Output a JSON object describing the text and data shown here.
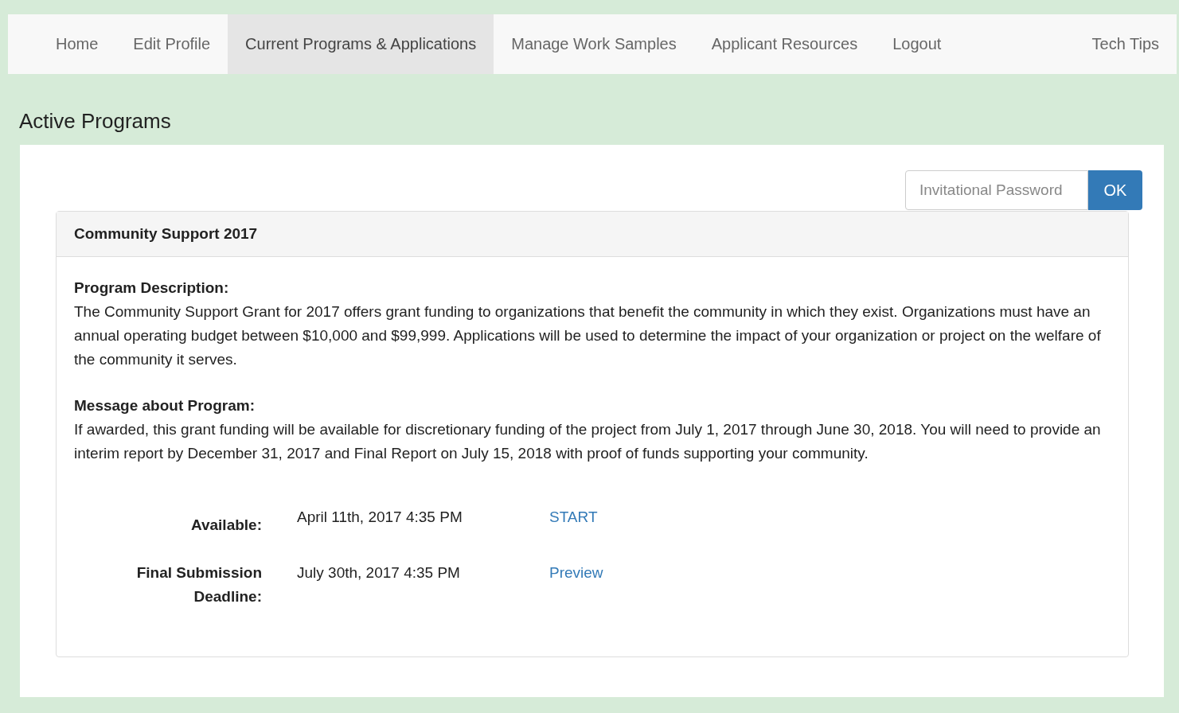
{
  "nav": {
    "items": [
      {
        "label": "Home",
        "selected": false
      },
      {
        "label": "Edit Profile",
        "selected": false
      },
      {
        "label": "Current Programs & Applications",
        "selected": true
      },
      {
        "label": "Manage Work Samples",
        "selected": false
      },
      {
        "label": "Applicant Resources",
        "selected": false
      },
      {
        "label": "Logout",
        "selected": false
      }
    ],
    "right_item": {
      "label": "Tech Tips",
      "selected": false
    }
  },
  "heading": "Active Programs",
  "password": {
    "placeholder": "Invitational Password",
    "button": "OK"
  },
  "program": {
    "title": "Community Support 2017",
    "sections": [
      {
        "heading": "Program Description:",
        "text": "The Community Support Grant for 2017 offers grant funding to organizations that benefit the community in which they exist. Organizations must have an annual operating budget between $10,000 and $99,999. Applications will be used to determine the impact of your organization or project on the welfare of the community it serves."
      },
      {
        "heading": "Message about Program:",
        "text": "If awarded, this grant funding will be available for discretionary funding of the project from July 1, 2017 through June 30, 2018. You will need to provide an interim report by December 31, 2017 and Final Report on July 15, 2018 with proof of funds supporting your community."
      }
    ],
    "dates": [
      {
        "label": "Available:",
        "value": "April 11th, 2017 4:35 PM",
        "link": "START"
      },
      {
        "label": "Final Submission Deadline:",
        "value": "July 30th, 2017 4:35 PM",
        "link": "Preview"
      }
    ]
  }
}
